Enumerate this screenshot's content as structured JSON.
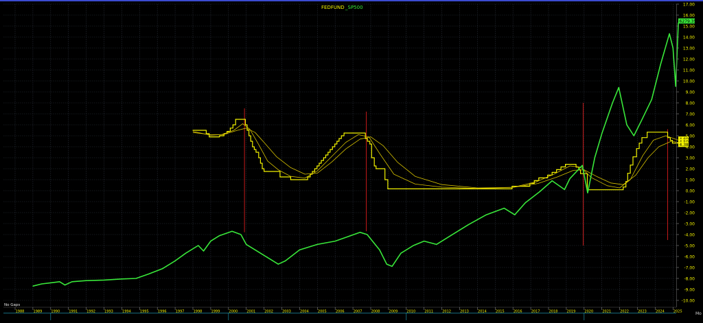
{
  "chart_data": {
    "type": "line",
    "title": "FEDFUND  _SP500",
    "title_parts": [
      "FEDFUND",
      "_SP500"
    ],
    "y_range": [
      -10.5,
      17.0
    ],
    "y_ticks": [
      17,
      16,
      15,
      14,
      13,
      12,
      11,
      10,
      9,
      8,
      7,
      6,
      5,
      4,
      3,
      2,
      1,
      0,
      -1,
      -2,
      -3,
      -4,
      -5,
      -6,
      -7,
      -8,
      -9,
      -10
    ],
    "y_tick_labels": [
      "17.00",
      "16.00",
      "15.00",
      "14.00",
      "13.00",
      "12.00",
      "11.00",
      "10.00",
      "9.00",
      "8.00",
      "7.00",
      "6.00",
      "5.00",
      "4.00",
      "3.00",
      "2.00",
      "1.00",
      "0.00",
      "-1.00",
      "-2.00",
      "-3.00",
      "-4.00",
      "-5.00",
      "-6.00",
      "-7.00",
      "-8.00",
      "-9.00",
      "-10.00"
    ],
    "x_year_labels": [
      "1988",
      "1989",
      "1990",
      "1991",
      "1992",
      "1993",
      "1994",
      "1995",
      "1996",
      "1997",
      "1998",
      "1999",
      "2000",
      "2001",
      "2002",
      "2003",
      "2004",
      "2005",
      "2006",
      "2007",
      "2008",
      "2009",
      "2010",
      "2011",
      "2012",
      "2013",
      "2014",
      "2015",
      "2016",
      "2017",
      "2018",
      "2019",
      "2020",
      "2021",
      "2022",
      "2023",
      "2024",
      "2025"
    ],
    "grid": true,
    "bottom_left_label": "No Gaps",
    "right_edge_label": "Mo",
    "last_value_labels": [
      {
        "text": "6279.35",
        "value": 15.45,
        "color": "#39e83a"
      },
      {
        "text": "4.69",
        "value": 4.69,
        "color": "#f3f300"
      },
      {
        "text": "4.50",
        "value": 4.45,
        "color": "#f3f300"
      },
      {
        "text": "4.38",
        "value": 4.2,
        "color": "#f3f300"
      }
    ],
    "colors": {
      "background": "#000000",
      "grid": "#2a2f3a",
      "fedfunds": "#f3f300",
      "averages": "#d8c300",
      "sp500": "#39e83a",
      "markers": "#c41a1a",
      "axis_text": "#f3f300",
      "title_text": "#f3f300"
    },
    "series": [
      {
        "name": "FEDFUND",
        "color": "#f3f300",
        "step": true,
        "x": [
          1998.0,
          1998.75,
          1998.92,
          1999.5,
          1999.75,
          1999.92,
          2000.1,
          2000.25,
          2000.4,
          2000.95,
          2001.05,
          2001.15,
          2001.25,
          2001.35,
          2001.45,
          2001.55,
          2001.7,
          2001.8,
          2001.9,
          2002.0,
          2002.9,
          2003.5,
          2004.45,
          2004.6,
          2004.72,
          2004.85,
          2004.98,
          2005.1,
          2005.22,
          2005.35,
          2005.47,
          2005.6,
          2005.72,
          2005.85,
          2005.98,
          2006.1,
          2006.22,
          2006.35,
          2006.5,
          2007.7,
          2007.82,
          2007.95,
          2008.05,
          2008.2,
          2008.3,
          2008.8,
          2008.96,
          2015.95,
          2016.95,
          2017.2,
          2017.45,
          2017.95,
          2018.2,
          2018.45,
          2018.7,
          2018.95,
          2019.55,
          2019.7,
          2019.8,
          2020.18,
          2022.2,
          2022.35,
          2022.45,
          2022.6,
          2022.75,
          2022.95,
          2023.1,
          2023.25,
          2023.55,
          2024.7,
          2024.85,
          2024.97,
          2025.3
        ],
        "values": [
          5.5,
          5.2,
          4.9,
          5.0,
          5.2,
          5.4,
          5.7,
          6.0,
          6.5,
          6.0,
          5.5,
          5.0,
          4.5,
          4.0,
          3.75,
          3.5,
          3.0,
          2.5,
          2.0,
          1.75,
          1.25,
          1.0,
          1.25,
          1.5,
          1.75,
          2.0,
          2.25,
          2.5,
          2.75,
          3.0,
          3.25,
          3.5,
          3.75,
          4.0,
          4.25,
          4.5,
          4.75,
          5.0,
          5.25,
          4.75,
          4.5,
          4.25,
          3.0,
          2.25,
          2.0,
          1.0,
          0.16,
          0.4,
          0.66,
          0.91,
          1.16,
          1.41,
          1.66,
          1.91,
          2.16,
          2.4,
          2.15,
          1.9,
          1.55,
          0.08,
          0.33,
          0.83,
          1.58,
          2.33,
          3.08,
          3.83,
          4.33,
          4.83,
          5.33,
          4.83,
          4.58,
          4.33,
          4.33
        ]
      },
      {
        "name": "FEDFUND fast average",
        "color": "#d8c300",
        "x": [
          1998.0,
          1999.0,
          1999.6,
          2000.3,
          2000.8,
          2001.2,
          2001.7,
          2002.2,
          2002.8,
          2003.5,
          2004.3,
          2005.0,
          2005.8,
          2006.6,
          2007.3,
          2007.9,
          2008.5,
          2009.3,
          2010.5,
          2012.0,
          2014.0,
          2016.0,
          2017.3,
          2018.3,
          2019.2,
          2019.8,
          2020.4,
          2021.3,
          2022.0,
          2022.6,
          2023.3,
          2023.9,
          2024.6,
          2025.3
        ],
        "values": [
          5.4,
          5.05,
          5.1,
          5.5,
          6.1,
          5.6,
          4.2,
          2.7,
          1.9,
          1.3,
          1.15,
          1.8,
          3.1,
          4.4,
          5.1,
          4.9,
          3.4,
          1.5,
          0.6,
          0.32,
          0.2,
          0.3,
          0.8,
          1.5,
          2.25,
          2.15,
          1.2,
          0.45,
          0.25,
          1.0,
          3.2,
          4.6,
          5.0,
          4.6
        ]
      },
      {
        "name": "FEDFUND slow average",
        "color": "#d8c300",
        "x": [
          1998.0,
          1999.0,
          1999.7,
          2000.5,
          2001.0,
          2001.5,
          2002.0,
          2002.7,
          2003.5,
          2004.3,
          2005.0,
          2005.8,
          2006.6,
          2007.4,
          2008.0,
          2008.7,
          2009.5,
          2010.5,
          2012.0,
          2014.0,
          2016.0,
          2017.4,
          2018.5,
          2019.4,
          2020.0,
          2020.7,
          2021.5,
          2022.2,
          2022.9,
          2023.6,
          2024.2,
          2024.9,
          2025.3
        ],
        "values": [
          5.3,
          5.1,
          5.1,
          5.5,
          5.7,
          5.3,
          4.4,
          3.1,
          2.1,
          1.5,
          1.6,
          2.6,
          3.8,
          4.7,
          4.9,
          4.1,
          2.6,
          1.3,
          0.55,
          0.25,
          0.3,
          0.65,
          1.25,
          1.85,
          1.9,
          1.3,
          0.7,
          0.55,
          1.4,
          3.0,
          4.0,
          4.5,
          4.4
        ]
      },
      {
        "name": "_SP500",
        "color": "#39e83a",
        "x": [
          1989.0,
          1989.5,
          1990.0,
          1990.5,
          1990.8,
          1991.2,
          1992.0,
          1993.0,
          1994.0,
          1994.8,
          1995.5,
          1996.3,
          1997.0,
          1997.6,
          1998.3,
          1998.6,
          1999.0,
          1999.5,
          2000.2,
          2000.7,
          2001.0,
          2001.7,
          2002.4,
          2002.8,
          2003.2,
          2004.0,
          2005.0,
          2006.0,
          2006.7,
          2007.4,
          2007.8,
          2008.5,
          2008.9,
          2009.2,
          2009.7,
          2010.4,
          2011.0,
          2011.7,
          2012.5,
          2013.5,
          2014.5,
          2015.5,
          2016.1,
          2016.7,
          2017.5,
          2018.2,
          2018.9,
          2019.2,
          2019.9,
          2020.2,
          2020.6,
          2021.0,
          2021.6,
          2021.95,
          2022.4,
          2022.8,
          2023.2,
          2023.8,
          2024.3,
          2024.8,
          2025.0,
          2025.15,
          2025.3
        ],
        "values": [
          -8.7,
          -8.5,
          -8.4,
          -8.3,
          -8.6,
          -8.3,
          -8.2,
          -8.15,
          -8.05,
          -8.0,
          -7.6,
          -7.1,
          -6.4,
          -5.7,
          -5.0,
          -5.5,
          -4.6,
          -4.1,
          -3.7,
          -4.0,
          -4.9,
          -5.6,
          -6.3,
          -6.7,
          -6.4,
          -5.4,
          -4.9,
          -4.6,
          -4.2,
          -3.8,
          -4.0,
          -5.4,
          -6.7,
          -6.9,
          -5.7,
          -5.0,
          -4.6,
          -4.9,
          -4.1,
          -3.1,
          -2.2,
          -1.6,
          -2.2,
          -1.1,
          -0.1,
          0.9,
          0.1,
          1.1,
          2.3,
          -0.2,
          3.0,
          5.2,
          8.0,
          9.4,
          6.0,
          5.0,
          6.3,
          8.3,
          11.5,
          14.3,
          13.0,
          9.5,
          15.3
        ]
      }
    ],
    "vertical_markers": [
      {
        "x": 2000.9,
        "y_top": 7.5,
        "y_bottom": -3.8
      },
      {
        "x": 2007.75,
        "y_top": 7.2,
        "y_bottom": -3.7
      },
      {
        "x": 2019.95,
        "y_top": 8.0,
        "y_bottom": -5.0
      },
      {
        "x": 2024.7,
        "y_top": 5.6,
        "y_bottom": -4.5
      }
    ]
  }
}
